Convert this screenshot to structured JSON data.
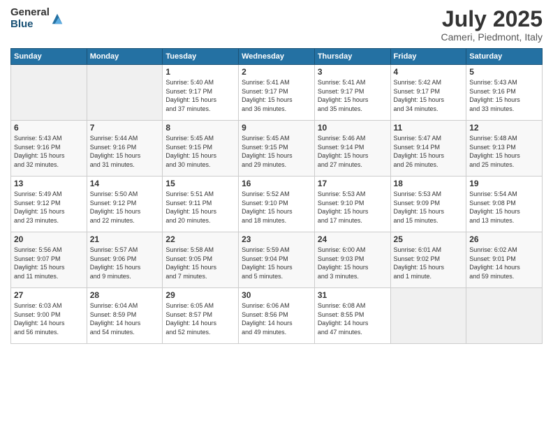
{
  "logo": {
    "general": "General",
    "blue": "Blue"
  },
  "title": "July 2025",
  "location": "Cameri, Piedmont, Italy",
  "days_header": [
    "Sunday",
    "Monday",
    "Tuesday",
    "Wednesday",
    "Thursday",
    "Friday",
    "Saturday"
  ],
  "weeks": [
    [
      {
        "day": "",
        "info": ""
      },
      {
        "day": "",
        "info": ""
      },
      {
        "day": "1",
        "info": "Sunrise: 5:40 AM\nSunset: 9:17 PM\nDaylight: 15 hours\nand 37 minutes."
      },
      {
        "day": "2",
        "info": "Sunrise: 5:41 AM\nSunset: 9:17 PM\nDaylight: 15 hours\nand 36 minutes."
      },
      {
        "day": "3",
        "info": "Sunrise: 5:41 AM\nSunset: 9:17 PM\nDaylight: 15 hours\nand 35 minutes."
      },
      {
        "day": "4",
        "info": "Sunrise: 5:42 AM\nSunset: 9:17 PM\nDaylight: 15 hours\nand 34 minutes."
      },
      {
        "day": "5",
        "info": "Sunrise: 5:43 AM\nSunset: 9:16 PM\nDaylight: 15 hours\nand 33 minutes."
      }
    ],
    [
      {
        "day": "6",
        "info": "Sunrise: 5:43 AM\nSunset: 9:16 PM\nDaylight: 15 hours\nand 32 minutes."
      },
      {
        "day": "7",
        "info": "Sunrise: 5:44 AM\nSunset: 9:16 PM\nDaylight: 15 hours\nand 31 minutes."
      },
      {
        "day": "8",
        "info": "Sunrise: 5:45 AM\nSunset: 9:15 PM\nDaylight: 15 hours\nand 30 minutes."
      },
      {
        "day": "9",
        "info": "Sunrise: 5:45 AM\nSunset: 9:15 PM\nDaylight: 15 hours\nand 29 minutes."
      },
      {
        "day": "10",
        "info": "Sunrise: 5:46 AM\nSunset: 9:14 PM\nDaylight: 15 hours\nand 27 minutes."
      },
      {
        "day": "11",
        "info": "Sunrise: 5:47 AM\nSunset: 9:14 PM\nDaylight: 15 hours\nand 26 minutes."
      },
      {
        "day": "12",
        "info": "Sunrise: 5:48 AM\nSunset: 9:13 PM\nDaylight: 15 hours\nand 25 minutes."
      }
    ],
    [
      {
        "day": "13",
        "info": "Sunrise: 5:49 AM\nSunset: 9:12 PM\nDaylight: 15 hours\nand 23 minutes."
      },
      {
        "day": "14",
        "info": "Sunrise: 5:50 AM\nSunset: 9:12 PM\nDaylight: 15 hours\nand 22 minutes."
      },
      {
        "day": "15",
        "info": "Sunrise: 5:51 AM\nSunset: 9:11 PM\nDaylight: 15 hours\nand 20 minutes."
      },
      {
        "day": "16",
        "info": "Sunrise: 5:52 AM\nSunset: 9:10 PM\nDaylight: 15 hours\nand 18 minutes."
      },
      {
        "day": "17",
        "info": "Sunrise: 5:53 AM\nSunset: 9:10 PM\nDaylight: 15 hours\nand 17 minutes."
      },
      {
        "day": "18",
        "info": "Sunrise: 5:53 AM\nSunset: 9:09 PM\nDaylight: 15 hours\nand 15 minutes."
      },
      {
        "day": "19",
        "info": "Sunrise: 5:54 AM\nSunset: 9:08 PM\nDaylight: 15 hours\nand 13 minutes."
      }
    ],
    [
      {
        "day": "20",
        "info": "Sunrise: 5:56 AM\nSunset: 9:07 PM\nDaylight: 15 hours\nand 11 minutes."
      },
      {
        "day": "21",
        "info": "Sunrise: 5:57 AM\nSunset: 9:06 PM\nDaylight: 15 hours\nand 9 minutes."
      },
      {
        "day": "22",
        "info": "Sunrise: 5:58 AM\nSunset: 9:05 PM\nDaylight: 15 hours\nand 7 minutes."
      },
      {
        "day": "23",
        "info": "Sunrise: 5:59 AM\nSunset: 9:04 PM\nDaylight: 15 hours\nand 5 minutes."
      },
      {
        "day": "24",
        "info": "Sunrise: 6:00 AM\nSunset: 9:03 PM\nDaylight: 15 hours\nand 3 minutes."
      },
      {
        "day": "25",
        "info": "Sunrise: 6:01 AM\nSunset: 9:02 PM\nDaylight: 15 hours\nand 1 minute."
      },
      {
        "day": "26",
        "info": "Sunrise: 6:02 AM\nSunset: 9:01 PM\nDaylight: 14 hours\nand 59 minutes."
      }
    ],
    [
      {
        "day": "27",
        "info": "Sunrise: 6:03 AM\nSunset: 9:00 PM\nDaylight: 14 hours\nand 56 minutes."
      },
      {
        "day": "28",
        "info": "Sunrise: 6:04 AM\nSunset: 8:59 PM\nDaylight: 14 hours\nand 54 minutes."
      },
      {
        "day": "29",
        "info": "Sunrise: 6:05 AM\nSunset: 8:57 PM\nDaylight: 14 hours\nand 52 minutes."
      },
      {
        "day": "30",
        "info": "Sunrise: 6:06 AM\nSunset: 8:56 PM\nDaylight: 14 hours\nand 49 minutes."
      },
      {
        "day": "31",
        "info": "Sunrise: 6:08 AM\nSunset: 8:55 PM\nDaylight: 14 hours\nand 47 minutes."
      },
      {
        "day": "",
        "info": ""
      },
      {
        "day": "",
        "info": ""
      }
    ]
  ]
}
